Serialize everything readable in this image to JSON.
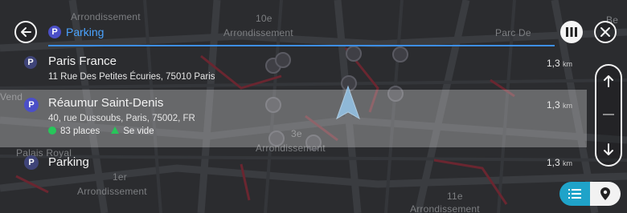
{
  "map": {
    "labels": [
      "Arrondissement",
      "10e",
      "Arrondissement",
      "Parc De",
      "Be",
      "Vend",
      "3e",
      "Arrondissement",
      "Palais Royal",
      "1er",
      "Arrondissement",
      "11e",
      "Arrondissement"
    ],
    "colors": {
      "background": "#2a2b2d",
      "road": "#3b3d40",
      "route_red": "#7a2a33",
      "poi_parking": "#4b4fc8"
    }
  },
  "header": {
    "back_icon": "arrow-left-icon",
    "search_value": "Parking",
    "search_icon": "parking-badge-icon",
    "columns_icon": "columns-icon",
    "close_icon": "close-icon"
  },
  "results": [
    {
      "icon": "parking-badge-icon",
      "name": "Paris France",
      "address": "11 Rue Des Petites Écuries, 75010 Paris",
      "distance": "1,3",
      "unit": "km"
    },
    {
      "icon": "parking-badge-icon",
      "name": "Réaumur Saint-Denis",
      "address": "40, rue Dussoubs, Paris, 75002, FR",
      "distance": "1,3",
      "unit": "km",
      "places": "83 places",
      "status": "Se vide"
    },
    {
      "icon": "parking-badge-icon",
      "name": "Parking",
      "address": "",
      "distance": "1,3",
      "unit": "km"
    }
  ],
  "scroll": {
    "up_icon": "arrow-up-icon",
    "down_icon": "arrow-down-icon"
  },
  "view_toggle": {
    "list_icon": "list-icon",
    "map_icon": "map-pin-icon",
    "active": "list"
  },
  "accent_colors": {
    "blue": "#3d8fe6",
    "green": "#27c65a",
    "teal": "#1fa3c9"
  }
}
